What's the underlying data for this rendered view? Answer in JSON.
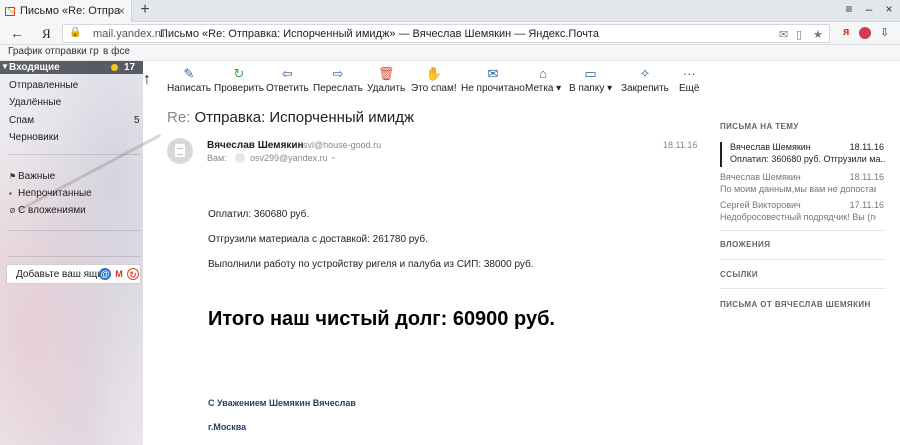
{
  "browser": {
    "tab_title": "Письмо «Re: Отправка: И",
    "url_domain": "mail.yandex.ru",
    "url_title": "Письмо «Re: Отправка: Испорченный имидж» — Вячеслав Шемякин — Яндекс.Почта",
    "logo": "Я",
    "bookmarks": [
      "График отправки гр",
      "в фсе"
    ]
  },
  "sidebar": {
    "inbox": {
      "label": "Входящие",
      "count": "17"
    },
    "folders": [
      {
        "label": "Отправленные",
        "count": ""
      },
      {
        "label": "Удалённые",
        "count": ""
      },
      {
        "label": "Спам",
        "count": "5"
      },
      {
        "label": "Черновики",
        "count": ""
      }
    ],
    "labels": [
      {
        "label": "Важные",
        "icon": "flag-icon"
      },
      {
        "label": "Непрочитанные",
        "icon": "envelope-icon"
      },
      {
        "label": "С вложениями",
        "icon": "paperclip-icon"
      }
    ],
    "add_mailbox": "Добавьте ваш ящик"
  },
  "toolbar": {
    "items": [
      {
        "label": "Написать",
        "icon": "compose-icon"
      },
      {
        "label": "Проверить",
        "icon": "refresh-icon"
      },
      {
        "label": "Ответить",
        "icon": "reply-icon"
      },
      {
        "label": "Переслать",
        "icon": "forward-icon"
      },
      {
        "label": "Удалить",
        "icon": "trash-icon"
      },
      {
        "label": "Это спам!",
        "icon": "spam-icon"
      },
      {
        "label": "Не прочитано",
        "icon": "envelope-icon"
      },
      {
        "label": "Метка ▾",
        "icon": "tag-icon"
      },
      {
        "label": "В папку ▾",
        "icon": "folder-icon"
      },
      {
        "label": "Закрепить",
        "icon": "pin-icon"
      },
      {
        "label": "Ещё",
        "icon": "more-icon"
      }
    ]
  },
  "message": {
    "subject_prefix": "Re:",
    "subject": "Отправка: Испорченный имидж",
    "sender_name": "Вячеслав Шемякин",
    "sender_email": "svl@house-good.ru",
    "to_label": "Вам:",
    "to_email": "osv299@yandex.ru",
    "date": "18.11.16",
    "body_lines": [
      "Оплатил: 360680 руб.",
      "Отгрузили материала с доставкой: 261780 руб.",
      "Выполнили работу по устройству ригеля и палуба из СИП: 38000 руб."
    ],
    "total_line": "Итого наш чистый долг: 60900 руб.",
    "signature": [
      "С Уважением Шемякин Вячеслав",
      "г.Москва"
    ]
  },
  "right_panel": {
    "thread_heading": "ПИСЬМА НА ТЕМУ",
    "threads": [
      {
        "name": "Вячеслав Шемякин",
        "date": "18.11.16",
        "snippet": "Оплатил: 360680 руб. Отгрузили ма...",
        "active": true
      },
      {
        "name": "Вячеслав Шемякин",
        "date": "18.11.16",
        "snippet": "По моим данным,мы вам не допостав...",
        "active": false
      },
      {
        "name": "Сергей Викторович",
        "date": "17.11.16",
        "snippet": "Недобросовестный подрядчик! Вы (по...",
        "active": false
      }
    ],
    "sections": [
      "ВЛОЖЕНИЯ",
      "ССЫЛКИ",
      "ПИСЬМА ОТ ВЯЧЕСЛАВ ШЕМЯКИН"
    ]
  },
  "colors": {
    "inbox_dot": "#f7c617",
    "toolbar_icon": "#2d5fa5",
    "check_icon": "#3aa64c",
    "delete_icon": "#d34a3a",
    "spam_icon": "#e9a21b",
    "signature": "#2a3f62"
  }
}
